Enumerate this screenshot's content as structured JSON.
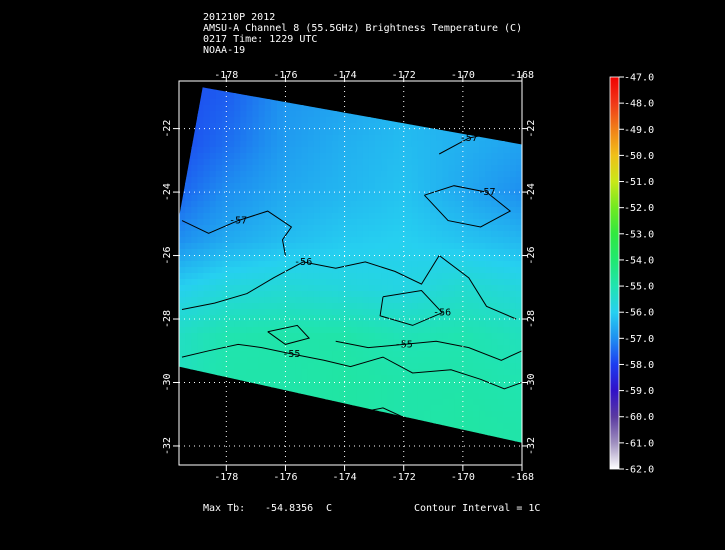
{
  "header": {
    "line1": "201210P 2012",
    "line2": "AMSU-A Channel 8 (55.5GHz) Brightness Temperature (C)",
    "line3": "0217 Time: 1229 UTC",
    "line4": "NOAA-19"
  },
  "footer": {
    "max_label": "Max Tb:",
    "max_value": "-54.8356",
    "max_unit": "C",
    "contour_interval": "Contour Interval = 1C"
  },
  "chart_data": {
    "type": "heatmap",
    "x": {
      "ticks": [
        -178,
        -176,
        -174,
        -172,
        -170,
        -168
      ],
      "labels": [
        "-178",
        "-176",
        "-174",
        "-172",
        "-170",
        "-168"
      ],
      "range": [
        -179.6,
        -168
      ]
    },
    "y": {
      "ticks": [
        -22,
        -24,
        -26,
        -28,
        -30,
        -32
      ],
      "labels": [
        "-22",
        "-24",
        "-26",
        "-28",
        "-30",
        "-32"
      ],
      "range": [
        -32.6,
        -20.5
      ]
    },
    "grid": true,
    "colorbar": {
      "ticks": [
        -47,
        -48,
        -49,
        -50,
        -51,
        -52,
        -53,
        -54,
        -55,
        -56,
        -57,
        -58,
        -59,
        -60,
        -61,
        -62
      ],
      "labels": [
        "-47.0",
        "-48.0",
        "-49.0",
        "-50.0",
        "-51.0",
        "-52.0",
        "-53.0",
        "-54.0",
        "-55.0",
        "-56.0",
        "-57.0",
        "-58.0",
        "-59.0",
        "-60.0",
        "-61.0",
        "-62.0"
      ],
      "range": [
        -62,
        -47
      ],
      "colors": [
        {
          "v": -62,
          "c": "#ffffff"
        },
        {
          "v": -61,
          "c": "#9f8fbf"
        },
        {
          "v": -60,
          "c": "#5a3aa0"
        },
        {
          "v": -59,
          "c": "#3010c8"
        },
        {
          "v": -58,
          "c": "#1c3cf0"
        },
        {
          "v": -57,
          "c": "#1e8ff0"
        },
        {
          "v": -56,
          "c": "#26d0f0"
        },
        {
          "v": -55,
          "c": "#20e4b0"
        },
        {
          "v": -54,
          "c": "#20e870"
        },
        {
          "v": -53,
          "c": "#30e840"
        },
        {
          "v": -52,
          "c": "#70ea20"
        },
        {
          "v": -51,
          "c": "#c8e818"
        },
        {
          "v": -50,
          "c": "#f0c018"
        },
        {
          "v": -49,
          "c": "#f08018"
        },
        {
          "v": -48,
          "c": "#f03818"
        },
        {
          "v": -47,
          "c": "#f00000"
        }
      ]
    },
    "swath": [
      [
        -178.8,
        -20.7
      ],
      [
        -168,
        -22.5
      ],
      [
        -168,
        -31.9
      ],
      [
        -179.6,
        -29.5
      ],
      [
        -179.6,
        -24.8
      ]
    ],
    "field": {
      "lon": [
        -179.6,
        -178,
        -176,
        -174,
        -172,
        -170,
        -168
      ],
      "lat": [
        -21,
        -22.5,
        -24,
        -25.5,
        -27,
        -28.5,
        -30,
        -31.5
      ],
      "values": [
        [
          -57.8,
          -57.6,
          -56.9,
          -56.7,
          -56.4,
          -56.5,
          -56.6
        ],
        [
          -57.8,
          -57.4,
          -56.8,
          -56.5,
          -56.3,
          -56.5,
          -56.7
        ],
        [
          -57.5,
          -57.0,
          -56.6,
          -56.4,
          -56.2,
          -56.6,
          -57.0
        ],
        [
          -57.0,
          -56.6,
          -56.3,
          -56.1,
          -56.0,
          -56.2,
          -56.4
        ],
        [
          -56.0,
          -55.7,
          -55.6,
          -55.7,
          -55.8,
          -55.5,
          -55.7
        ],
        [
          -55.3,
          -55.0,
          -54.9,
          -54.9,
          -55.1,
          -55.0,
          -55.2
        ],
        [
          -55.2,
          -54.9,
          -54.9,
          -54.8,
          -54.9,
          -54.9,
          -55.0
        ],
        [
          -55.1,
          -54.9,
          -54.8,
          -54.8,
          -54.9,
          -54.8,
          -54.9
        ]
      ]
    },
    "contours": [
      {
        "label": "-57",
        "points": [
          [
            -179.5,
            -24.9
          ],
          [
            -178.6,
            -25.3
          ],
          [
            -177.6,
            -24.9
          ],
          [
            -176.6,
            -24.6
          ],
          [
            -175.8,
            -25.1
          ],
          [
            -176.1,
            -25.5
          ],
          [
            -176.0,
            -26.0
          ]
        ]
      },
      {
        "label": "-57",
        "points": [
          [
            -171.3,
            -24.1
          ],
          [
            -170.3,
            -23.8
          ],
          [
            -169.2,
            -24.0
          ],
          [
            -168.4,
            -24.6
          ],
          [
            -169.4,
            -25.1
          ],
          [
            -170.5,
            -24.9
          ],
          [
            -171.3,
            -24.1
          ]
        ]
      },
      {
        "label": "-57",
        "points": [
          [
            -170.8,
            -22.8
          ],
          [
            -169.8,
            -22.3
          ],
          [
            -168.8,
            -22.1
          ]
        ]
      },
      {
        "label": "-56",
        "points": [
          [
            -179.5,
            -27.7
          ],
          [
            -178.4,
            -27.5
          ],
          [
            -177.3,
            -27.2
          ],
          [
            -176.4,
            -26.7
          ],
          [
            -175.4,
            -26.2
          ],
          [
            -174.3,
            -26.4
          ],
          [
            -173.3,
            -26.2
          ],
          [
            -172.3,
            -26.5
          ],
          [
            -171.4,
            -26.9
          ],
          [
            -170.8,
            -26.0
          ],
          [
            -169.8,
            -26.7
          ],
          [
            -169.2,
            -27.6
          ],
          [
            -168.2,
            -28.0
          ]
        ]
      },
      {
        "label": "-56",
        "points": [
          [
            -172.7,
            -27.3
          ],
          [
            -171.4,
            -27.1
          ],
          [
            -170.7,
            -27.8
          ],
          [
            -171.7,
            -28.2
          ],
          [
            -172.8,
            -27.9
          ],
          [
            -172.7,
            -27.3
          ]
        ]
      },
      {
        "label": "-55",
        "points": [
          [
            -174.3,
            -28.7
          ],
          [
            -173.2,
            -28.9
          ],
          [
            -172.0,
            -28.8
          ],
          [
            -170.9,
            -28.7
          ],
          [
            -169.8,
            -28.9
          ],
          [
            -168.7,
            -29.3
          ],
          [
            -168.0,
            -29.0
          ]
        ]
      },
      {
        "label": "-55",
        "points": [
          [
            -179.5,
            -29.2
          ],
          [
            -178.6,
            -29.0
          ],
          [
            -177.6,
            -28.8
          ],
          [
            -176.8,
            -28.9
          ],
          [
            -175.8,
            -29.1
          ],
          [
            -174.7,
            -29.3
          ],
          [
            -173.8,
            -29.5
          ],
          [
            -172.7,
            -29.2
          ],
          [
            -171.7,
            -29.7
          ],
          [
            -170.4,
            -29.6
          ],
          [
            -169.4,
            -29.9
          ],
          [
            -168.6,
            -30.2
          ],
          [
            -168.0,
            -30.0
          ]
        ]
      },
      {
        "label": "",
        "points": [
          [
            -176.6,
            -28.4
          ],
          [
            -175.6,
            -28.2
          ],
          [
            -175.2,
            -28.6
          ],
          [
            -176.0,
            -28.8
          ],
          [
            -176.6,
            -28.4
          ]
        ]
      },
      {
        "label": "",
        "points": [
          [
            -177.6,
            -30.3
          ],
          [
            -177.1,
            -30.1
          ],
          [
            -176.6,
            -30.4
          ],
          [
            -177.2,
            -30.6
          ],
          [
            -177.6,
            -30.3
          ]
        ]
      },
      {
        "label": "",
        "points": [
          [
            -173.8,
            -31.0
          ],
          [
            -172.7,
            -30.8
          ],
          [
            -172.0,
            -31.1
          ],
          [
            -172.8,
            -31.4
          ],
          [
            -173.8,
            -31.0
          ]
        ]
      }
    ]
  }
}
